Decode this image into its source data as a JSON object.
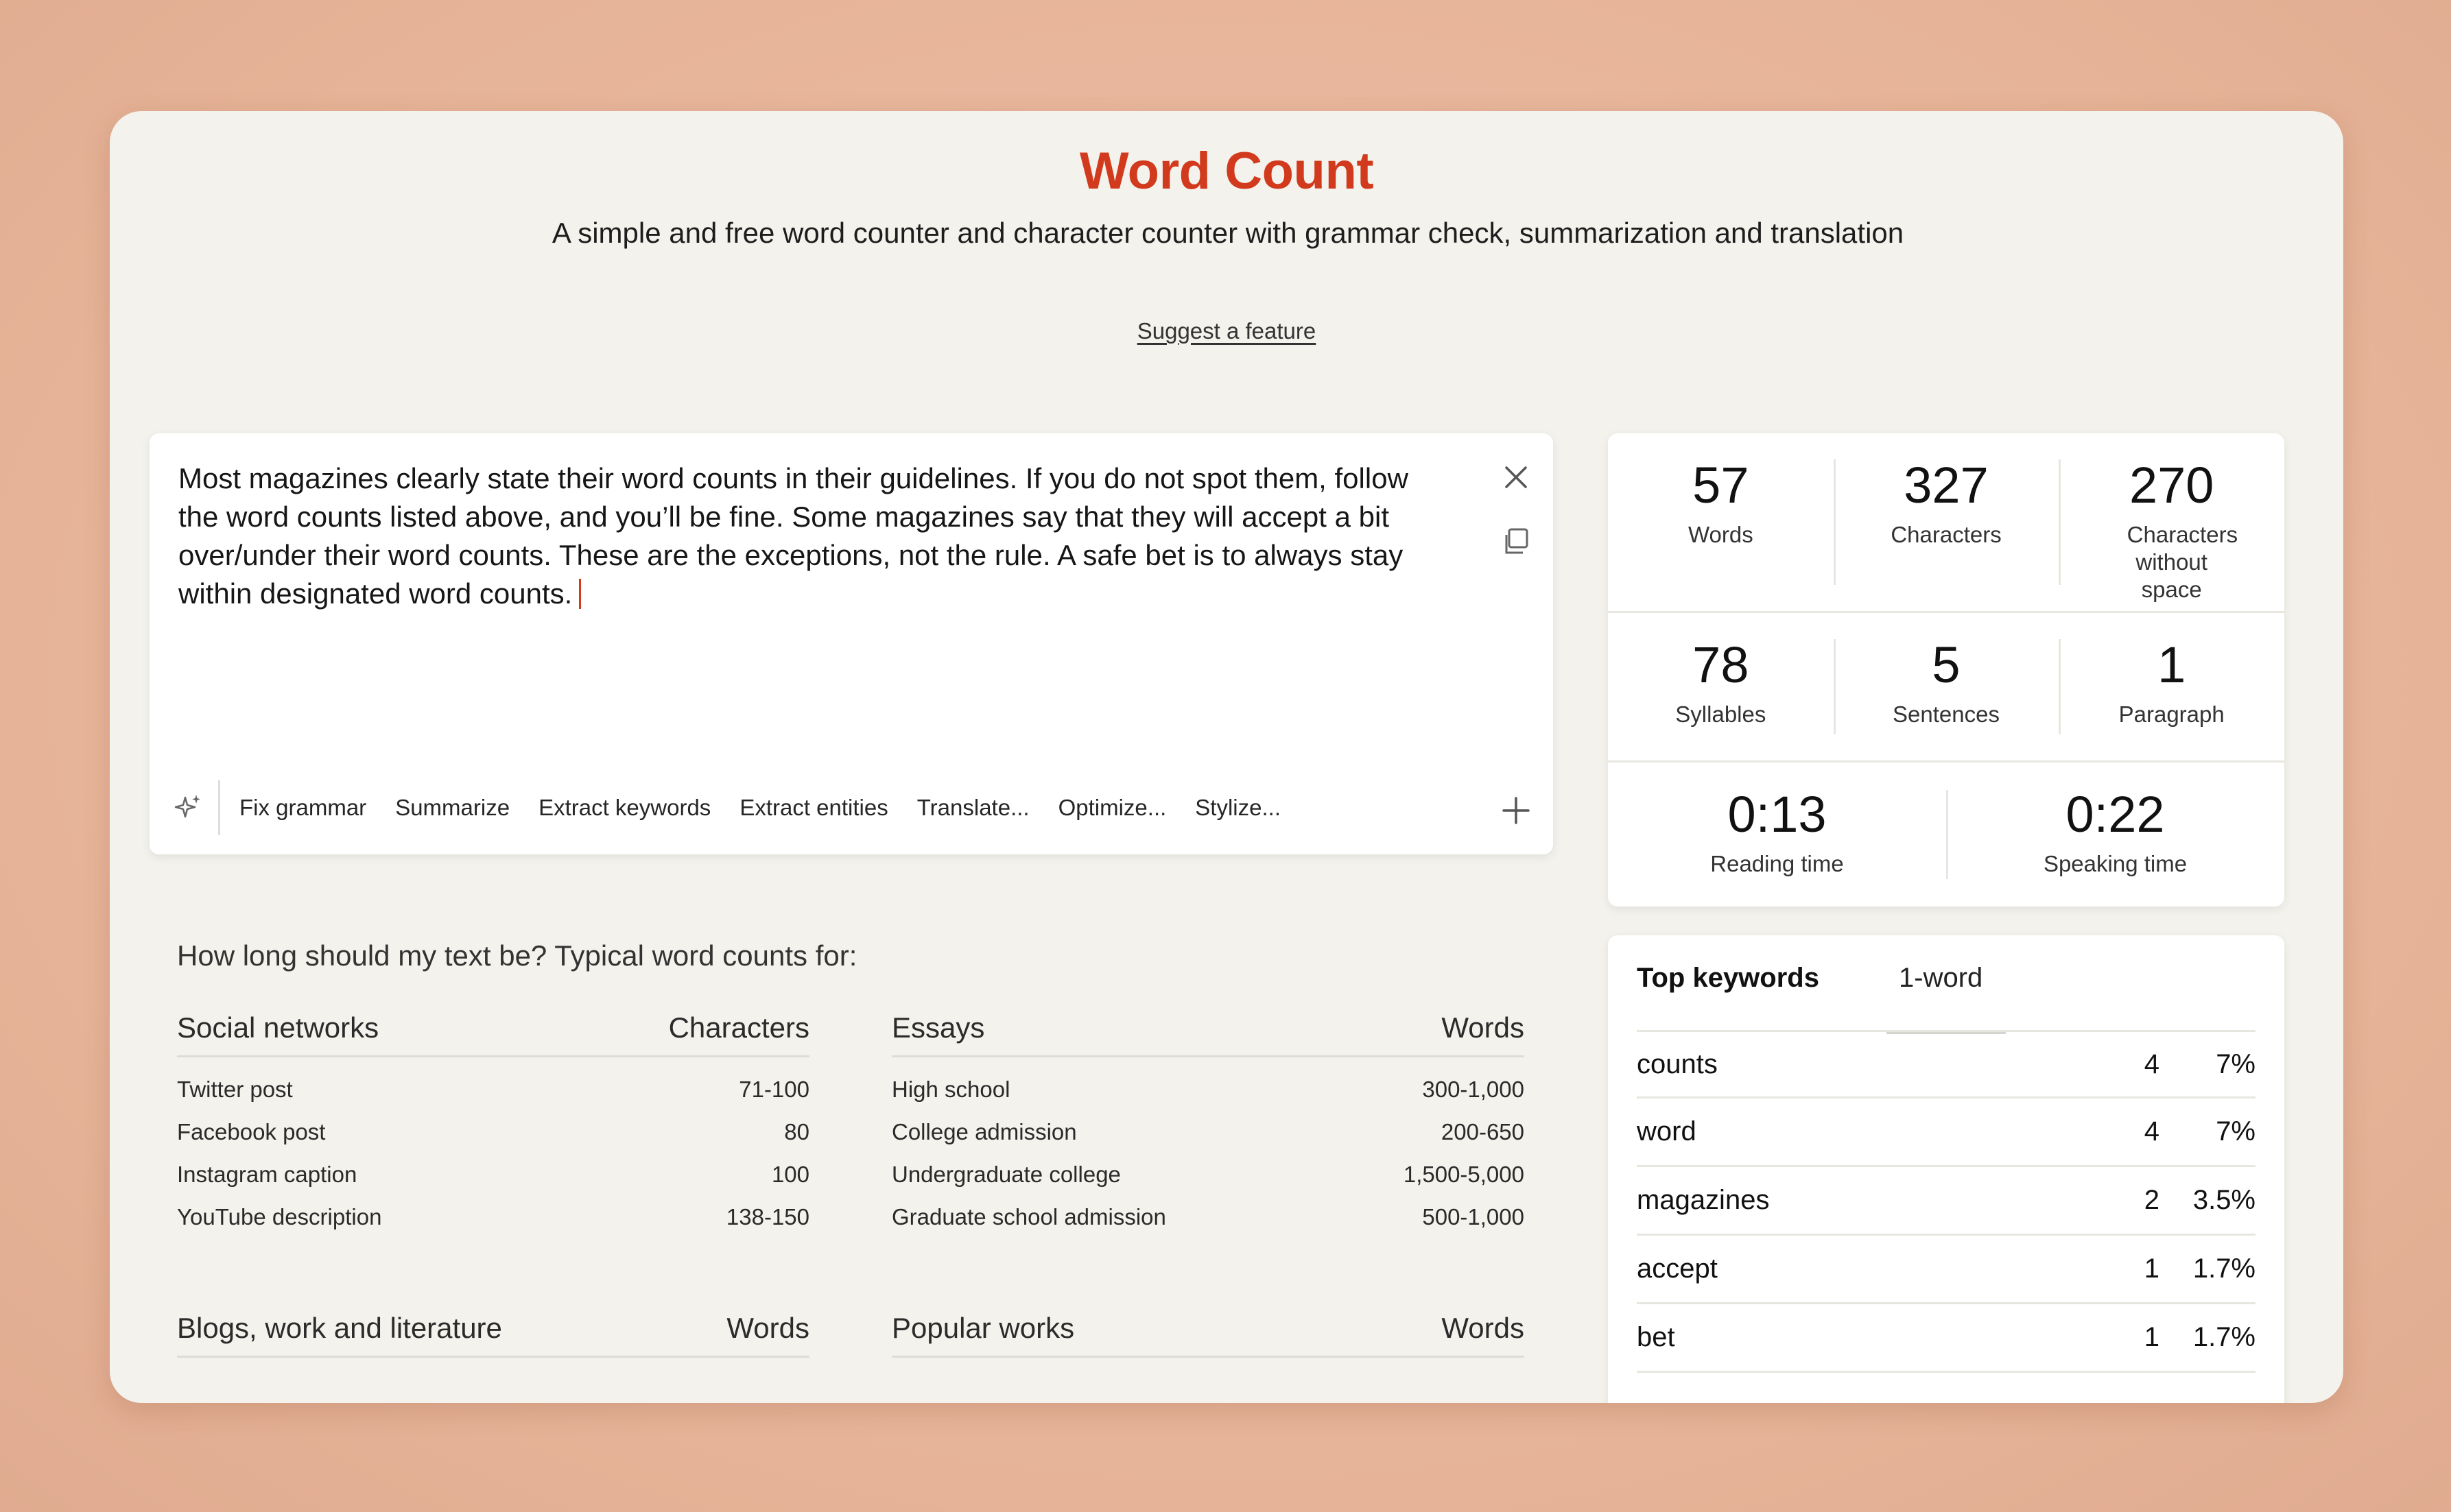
{
  "app": {
    "title": "Word Count",
    "subtitle": "A simple and free word counter and character counter with grammar check, summarization and translation",
    "suggest_link": "Suggest a feature"
  },
  "editor": {
    "text": "Most magazines clearly state their word counts in their guidelines. If you do not spot them, follow the word counts listed above, and you’ll be fine. Some magazines say that they will accept a bit over/under their word counts. These are the exceptions, not the rule. A safe bet is to always stay within designated word counts.",
    "icons": {
      "clear": "close-icon",
      "copy": "copy-icon",
      "ai": "sparkle-icon",
      "add": "plus-icon"
    },
    "toolbar": [
      "Fix grammar",
      "Summarize",
      "Extract keywords",
      "Extract entities",
      "Translate...",
      "Optimize...",
      "Stylize..."
    ]
  },
  "stats": {
    "words": {
      "value": "57",
      "label": "Words"
    },
    "characters": {
      "value": "327",
      "label": "Characters"
    },
    "chars_no_space": {
      "value": "270",
      "label": "Characters without space"
    },
    "syllables": {
      "value": "78",
      "label": "Syllables"
    },
    "sentences": {
      "value": "5",
      "label": "Sentences"
    },
    "paragraphs": {
      "value": "1",
      "label": "Paragraph"
    },
    "reading_time": {
      "value": "0:13",
      "label": "Reading time"
    },
    "speaking_time": {
      "value": "0:22",
      "label": "Speaking time"
    }
  },
  "keywords": {
    "title": "Top keywords",
    "tab": "1-word",
    "rows": [
      {
        "word": "counts",
        "count": "4",
        "pct": "7%"
      },
      {
        "word": "word",
        "count": "4",
        "pct": "7%"
      },
      {
        "word": "magazines",
        "count": "2",
        "pct": "3.5%"
      },
      {
        "word": "accept",
        "count": "1",
        "pct": "1.7%"
      },
      {
        "word": "bet",
        "count": "1",
        "pct": "1.7%"
      }
    ]
  },
  "typical": {
    "heading": "How long should my text be? Typical word counts for:",
    "social": {
      "title": "Social networks",
      "unit": "Characters",
      "rows": [
        {
          "name": "Twitter post",
          "value": "71-100"
        },
        {
          "name": "Facebook post",
          "value": "80"
        },
        {
          "name": "Instagram caption",
          "value": "100"
        },
        {
          "name": "YouTube description",
          "value": "138-150"
        }
      ]
    },
    "essays": {
      "title": "Essays",
      "unit": "Words",
      "rows": [
        {
          "name": "High school",
          "value": "300-1,000"
        },
        {
          "name": "College admission",
          "value": "200-650"
        },
        {
          "name": "Undergraduate college",
          "value": "1,500-5,000"
        },
        {
          "name": "Graduate school admission",
          "value": "500-1,000"
        }
      ]
    },
    "blogs": {
      "title": "Blogs, work and literature",
      "unit": "Words"
    },
    "popular": {
      "title": "Popular works",
      "unit": "Words"
    }
  }
}
